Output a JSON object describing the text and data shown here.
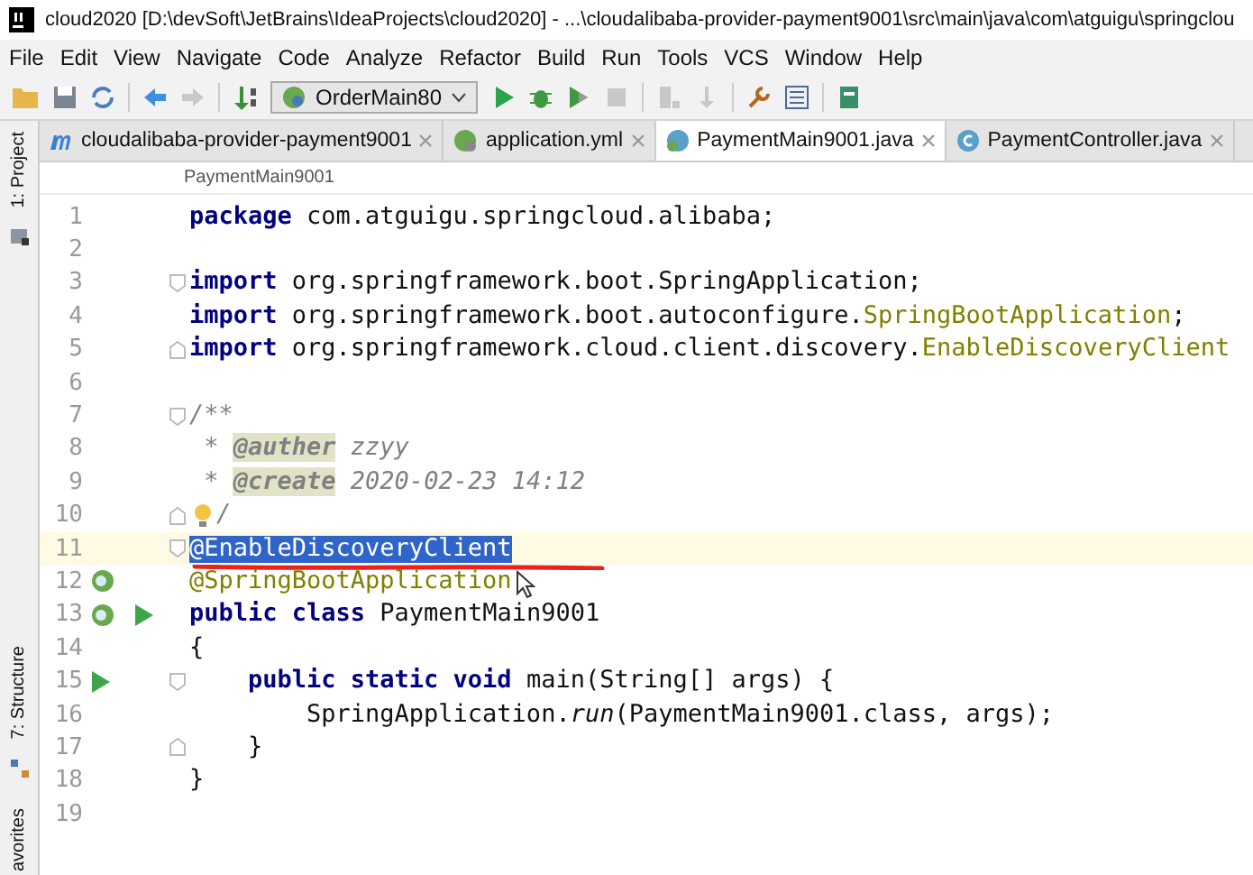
{
  "window": {
    "title": "cloud2020 [D:\\devSoft\\JetBrains\\IdeaProjects\\cloud2020] - ...\\cloudalibaba-provider-payment9001\\src\\main\\java\\com\\atguigu\\springclou"
  },
  "menu": [
    "File",
    "Edit",
    "View",
    "Navigate",
    "Code",
    "Analyze",
    "Refactor",
    "Build",
    "Run",
    "Tools",
    "VCS",
    "Window",
    "Help"
  ],
  "toolbar": {
    "run_config": "OrderMain80"
  },
  "tabs": [
    {
      "label": "cloudalibaba-provider-payment9001",
      "kind": "module",
      "selected": false
    },
    {
      "label": "application.yml",
      "kind": "yml",
      "selected": false
    },
    {
      "label": "PaymentMain9001.java",
      "kind": "spring",
      "selected": true
    },
    {
      "label": "PaymentController.java",
      "kind": "class",
      "selected": false
    }
  ],
  "breadcrumb": "PaymentMain9001",
  "side_panels": {
    "top": "1: Project",
    "middle": "7: Structure",
    "bottom": "avorites"
  },
  "editor": {
    "lines": [
      {
        "number": "1",
        "tokens": [
          {
            "kind": "kw",
            "text": "package"
          },
          {
            "kind": "plain",
            "text": " com.atguigu.springcloud.alibaba;"
          }
        ]
      },
      {
        "number": "2"
      },
      {
        "number": "3",
        "fold_start": true,
        "tokens": [
          {
            "kind": "kw",
            "text": "import"
          },
          {
            "kind": "plain",
            "text": " org.springframework.boot.SpringApplication;"
          }
        ]
      },
      {
        "number": "4",
        "tokens": [
          {
            "kind": "kw",
            "text": "import"
          },
          {
            "kind": "plain",
            "text": " org.springframework.boot.autoconfigure."
          },
          {
            "kind": "ref",
            "text": "SpringBootApplication"
          },
          {
            "kind": "plain",
            "text": ";"
          }
        ]
      },
      {
        "number": "5",
        "fold_end": true,
        "tokens": [
          {
            "kind": "kw",
            "text": "import"
          },
          {
            "kind": "plain",
            "text": " org.springframework.cloud.client.discovery."
          },
          {
            "kind": "ref",
            "text": "EnableDiscoveryClient"
          }
        ]
      },
      {
        "number": "6"
      },
      {
        "number": "7",
        "fold_start": true,
        "tokens": [
          {
            "kind": "doc",
            "text": "/**"
          }
        ]
      },
      {
        "number": "8",
        "tokens": [
          {
            "kind": "doc",
            "text": " * "
          },
          {
            "kind": "tag",
            "text": "@auther"
          },
          {
            "kind": "doc",
            "text": " zzyy"
          }
        ]
      },
      {
        "number": "9",
        "tokens": [
          {
            "kind": "doc",
            "text": " * "
          },
          {
            "kind": "tag",
            "text": "@create"
          },
          {
            "kind": "doc",
            "text": " 2020-02-23 14:12"
          }
        ]
      },
      {
        "number": "10",
        "fold_end": true,
        "bulb": true,
        "tokens": [
          {
            "kind": "doc",
            "text": "/"
          }
        ]
      },
      {
        "number": "11",
        "fold_start": true,
        "current": true,
        "selected": true,
        "tokens": [
          {
            "kind": "plain",
            "text": "@EnableDiscoveryClient"
          }
        ]
      },
      {
        "number": "12",
        "bean_icon": true,
        "tokens": [
          {
            "kind": "ref",
            "text": "@SpringBootApplication"
          }
        ]
      },
      {
        "number": "13",
        "bean_icon": true,
        "run_icon": true,
        "tokens": [
          {
            "kind": "kw",
            "text": "public class"
          },
          {
            "kind": "plain",
            "text": " PaymentMain9001"
          }
        ]
      },
      {
        "number": "14",
        "tokens": [
          {
            "kind": "plain",
            "text": "{"
          }
        ]
      },
      {
        "number": "15",
        "fold_start": true,
        "run_icon": true,
        "tokens": [
          {
            "kind": "kw",
            "text": "    public static void"
          },
          {
            "kind": "plain",
            "text": " main(String[] args) {"
          }
        ]
      },
      {
        "number": "16",
        "tokens": [
          {
            "kind": "plain",
            "text": "        SpringApplication."
          },
          {
            "kind": "italic",
            "text": "run"
          },
          {
            "kind": "plain",
            "text": "(PaymentMain9001.class, args);"
          }
        ]
      },
      {
        "number": "17",
        "fold_end": true,
        "tokens": [
          {
            "kind": "plain",
            "text": "    }"
          }
        ]
      },
      {
        "number": "18",
        "tokens": [
          {
            "kind": "plain",
            "text": "}"
          }
        ]
      },
      {
        "number": "19"
      }
    ]
  }
}
